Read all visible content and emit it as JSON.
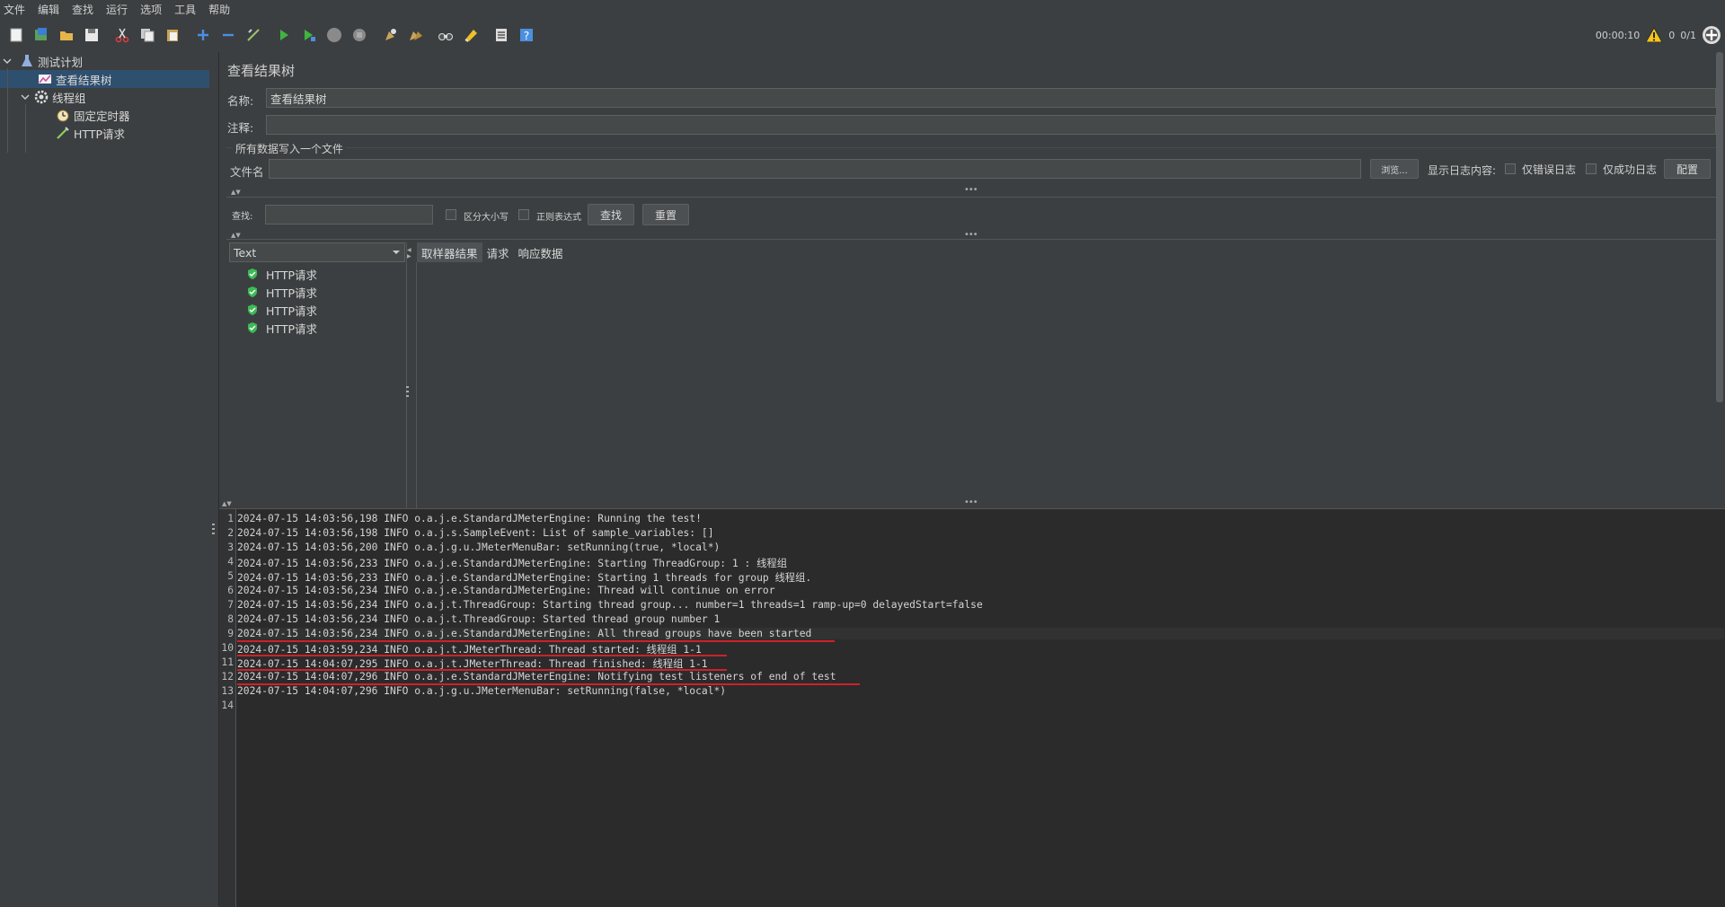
{
  "menu": [
    "文件",
    "编辑",
    "查找",
    "运行",
    "选项",
    "工具",
    "帮助"
  ],
  "toolbar": {
    "icons": [
      "new-icon",
      "templates-icon",
      "open-icon",
      "save-icon",
      "cut-icon",
      "copy-icon",
      "paste-icon",
      "expand-icon",
      "collapse-icon",
      "toggle-icon",
      "start-icon",
      "start-no-pause-icon",
      "stop-icon",
      "shutdown-icon",
      "clear-icon",
      "clear-all-icon",
      "search-icon",
      "reset-search-icon",
      "function-helper-icon",
      "help-icon"
    ]
  },
  "status": {
    "timer": "00:00:10",
    "warnings": "0",
    "threads": "0/1"
  },
  "tree": {
    "items": [
      {
        "label": "测试计划",
        "icon": "test-plan-icon"
      },
      {
        "label": "查看结果树",
        "icon": "result-tree-icon"
      },
      {
        "label": "线程组",
        "icon": "thread-group-icon"
      },
      {
        "label": "固定定时器",
        "icon": "timer-icon"
      },
      {
        "label": "HTTP请求",
        "icon": "http-sampler-icon"
      }
    ]
  },
  "panel": {
    "title": "查看结果树",
    "name_label": "名称:",
    "name_value": "查看结果树",
    "comment_label": "注释:",
    "comment_value": "",
    "file_section": "所有数据写入一个文件",
    "filename_label": "文件名",
    "filename_value": "",
    "browse_label": "浏览...",
    "log_display_label": "显示日志内容:",
    "errors_only_label": "仅错误日志",
    "success_only_label": "仅成功日志",
    "configure_label": "配置"
  },
  "search": {
    "label": "查找:",
    "value": "",
    "case_label": "区分大小写",
    "regex_label": "正则表达式",
    "find_label": "查找",
    "reset_label": "重置"
  },
  "results": {
    "renderer": "Text",
    "items": [
      "HTTP请求",
      "HTTP请求",
      "HTTP请求",
      "HTTP请求"
    ],
    "tabs": [
      "取样器结果",
      "请求",
      "响应数据"
    ]
  },
  "log": {
    "lines": [
      "2024-07-15 14:03:56,198 INFO o.a.j.e.StandardJMeterEngine: Running the test!",
      "2024-07-15 14:03:56,198 INFO o.a.j.s.SampleEvent: List of sample_variables: []",
      "2024-07-15 14:03:56,200 INFO o.a.j.g.u.JMeterMenuBar: setRunning(true, *local*)",
      "2024-07-15 14:03:56,233 INFO o.a.j.e.StandardJMeterEngine: Starting ThreadGroup: 1 : 线程组",
      "2024-07-15 14:03:56,233 INFO o.a.j.e.StandardJMeterEngine: Starting 1 threads for group 线程组.",
      "2024-07-15 14:03:56,234 INFO o.a.j.e.StandardJMeterEngine: Thread will continue on error",
      "2024-07-15 14:03:56,234 INFO o.a.j.t.ThreadGroup: Starting thread group... number=1 threads=1 ramp-up=0 delayedStart=false",
      "2024-07-15 14:03:56,234 INFO o.a.j.t.ThreadGroup: Started thread group number 1",
      "2024-07-15 14:03:56,234 INFO o.a.j.e.StandardJMeterEngine: All thread groups have been started",
      "2024-07-15 14:03:59,234 INFO o.a.j.t.JMeterThread: Thread started: 线程组 1-1",
      "2024-07-15 14:04:07,295 INFO o.a.j.t.JMeterThread: Thread finished: 线程组 1-1",
      "2024-07-15 14:04:07,296 INFO o.a.j.e.StandardJMeterEngine: Notifying test listeners of end of test",
      "2024-07-15 14:04:07,296 INFO o.a.j.g.u.JMeterMenuBar: setRunning(false, *local*)",
      ""
    ]
  },
  "colors": {
    "accent": "#2f4f6f",
    "underline": "#d0202a",
    "success": "#3cba54"
  }
}
